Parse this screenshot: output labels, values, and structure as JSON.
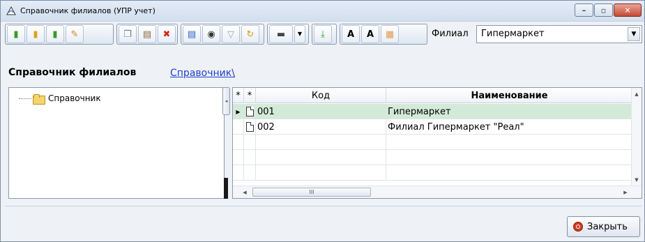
{
  "window": {
    "title": "Справочник филиалов (УПР учет)"
  },
  "toolbar": {
    "buttons": [
      {
        "icon": "add-icon"
      },
      {
        "icon": "add-group-icon"
      },
      {
        "icon": "copy-add-icon"
      },
      {
        "icon": "edit-icon"
      },
      {
        "icon": "copy-icon"
      },
      {
        "icon": "paste-icon"
      },
      {
        "icon": "delete-icon"
      },
      {
        "icon": "list-icon"
      },
      {
        "icon": "find-icon"
      },
      {
        "icon": "filter-icon"
      },
      {
        "icon": "refresh-icon"
      },
      {
        "icon": "print-icon"
      },
      {
        "icon": "export-icon"
      },
      {
        "icon": "font-larger-icon"
      },
      {
        "icon": "font-smaller-icon"
      },
      {
        "icon": "settings-icon"
      }
    ],
    "branch_label": "Филиал",
    "branch_value": "Гипермаркет"
  },
  "heading": {
    "title": "Справочник филиалов",
    "breadcrumb": "Справочник\\"
  },
  "tree": {
    "root_label": "Справочник"
  },
  "grid": {
    "columns": {
      "star1": "*",
      "star2": "*",
      "code": "Код",
      "name": "Наименование"
    },
    "rows": [
      {
        "code": "001",
        "name": "Гипермаркет"
      },
      {
        "code": "002",
        "name": "Филиал Гипермаркет \"Реал\""
      }
    ],
    "empty_rows": 4
  },
  "footer": {
    "close_label": "Закрыть"
  }
}
